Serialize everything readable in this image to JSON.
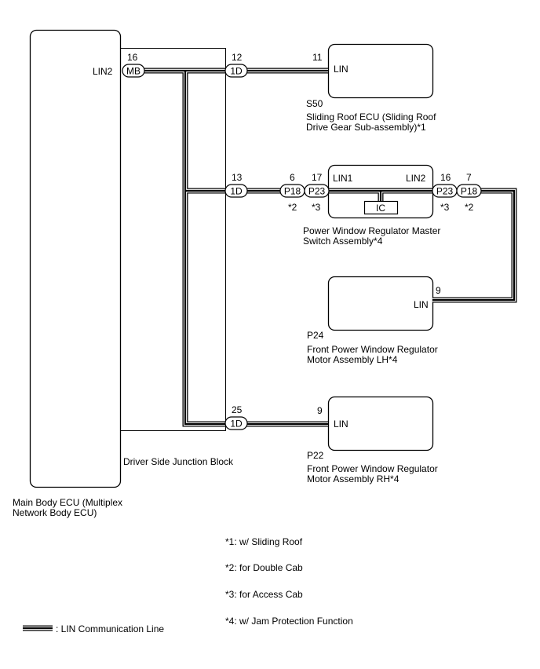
{
  "main_ecu": {
    "name_line1": "Main Body ECU (Multiplex",
    "name_line2": "Network Body ECU)",
    "terminal": "LIN2",
    "pin": "16",
    "connector": "MB"
  },
  "junction_block": {
    "name": "Driver Side Junction Block",
    "outputs": [
      {
        "pin": "12",
        "connector": "1D"
      },
      {
        "pin": "13",
        "connector": "1D"
      },
      {
        "pin": "25",
        "connector": "1D"
      }
    ]
  },
  "sliding_roof_ecu": {
    "code": "S50",
    "name_line1": "Sliding Roof ECU (Sliding Roof",
    "name_line2": "Drive Gear Sub-assembly)*1",
    "terminal": "LIN",
    "pin": "11"
  },
  "master_switch": {
    "name_line1": "Power Window Regulator Master",
    "name_line2": "Switch Assembly*4",
    "terminal_left": "LIN1",
    "terminal_right": "LIN2",
    "internal": "IC",
    "left_connectors": [
      {
        "pin": "6",
        "connector": "P18",
        "note": "*2"
      },
      {
        "pin": "17",
        "connector": "P23",
        "note": "*3"
      }
    ],
    "right_connectors": [
      {
        "pin": "16",
        "connector": "P23",
        "note": "*3"
      },
      {
        "pin": "7",
        "connector": "P18",
        "note": "*2"
      }
    ]
  },
  "motor_lh": {
    "code": "P24",
    "name_line1": "Front Power Window Regulator",
    "name_line2": "Motor Assembly LH*4",
    "terminal": "LIN",
    "pin": "9"
  },
  "motor_rh": {
    "code": "P22",
    "name_line1": "Front Power Window Regulator",
    "name_line2": "Motor Assembly RH*4",
    "terminal": "LIN",
    "pin": "9"
  },
  "notes": [
    "*1: w/ Sliding Roof",
    "*2: for Double Cab",
    "*3: for Access Cab",
    "*4: w/ Jam Protection Function"
  ],
  "legend": {
    "label": ": LIN Communication Line"
  }
}
